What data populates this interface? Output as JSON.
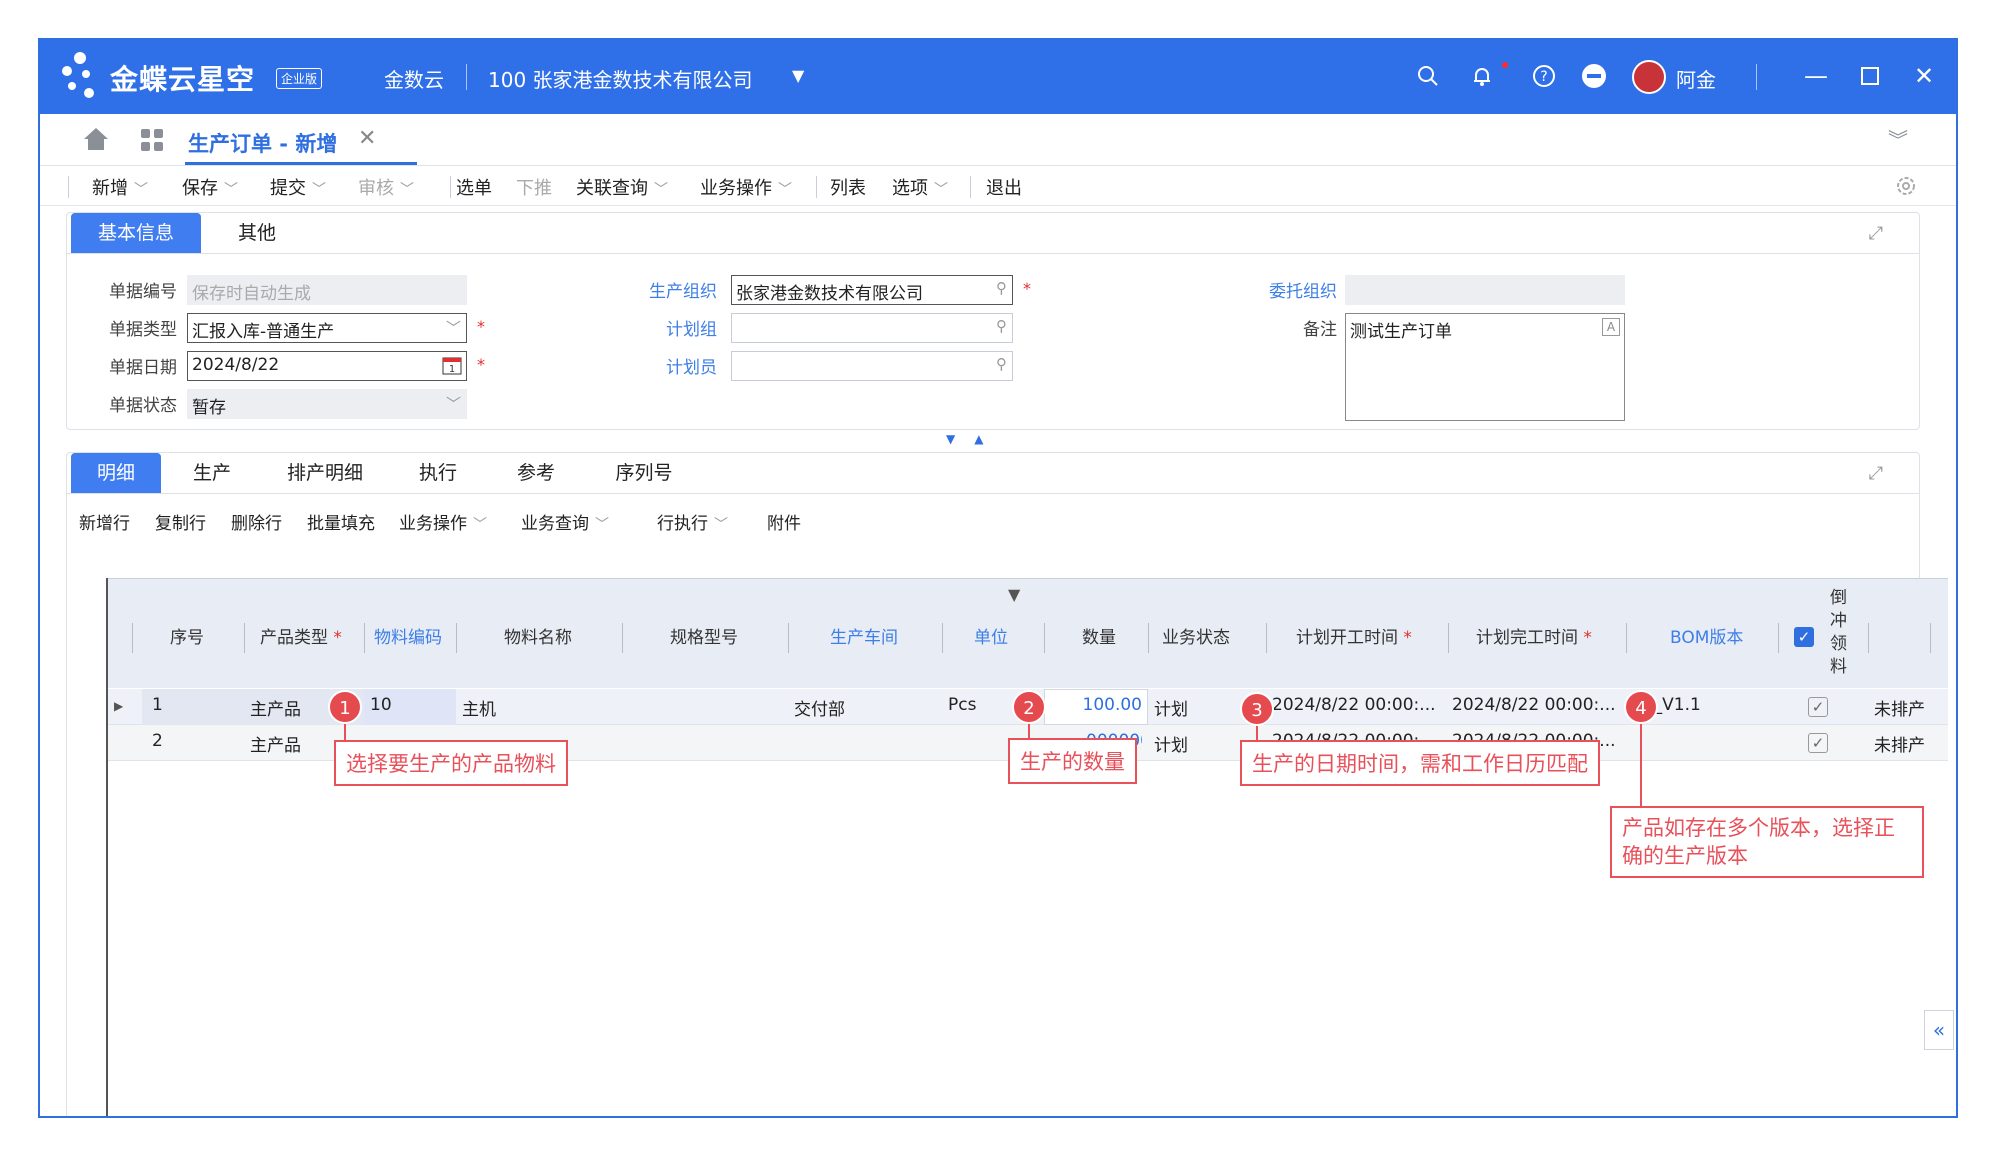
{
  "titlebar": {
    "brand": "金蝶云星空",
    "edition": "企业版",
    "product": "金数云",
    "company": "100  张家港金数技术有限公司",
    "user": "阿金"
  },
  "tabstrip": {
    "doc_tab": "生产订单 - 新增"
  },
  "toolbar": {
    "items": [
      "新增",
      "保存",
      "提交",
      "审核",
      "选单",
      "下推",
      "关联查询",
      "业务操作",
      "列表",
      "选项",
      "退出"
    ]
  },
  "header_panel": {
    "tabs": [
      "基本信息",
      "其他"
    ],
    "fields": {
      "bill_no_label": "单据编号",
      "bill_no_placeholder": "保存时自动生成",
      "bill_type_label": "单据类型",
      "bill_type": "汇报入库-普通生产",
      "bill_date_label": "单据日期",
      "bill_date": "2024/8/22",
      "bill_status_label": "单据状态",
      "bill_status": "暂存",
      "prod_org_label": "生产组织",
      "prod_org": "张家港金数技术有限公司",
      "plan_group_label": "计划组",
      "planner_label": "计划员",
      "entrust_org_label": "委托组织",
      "remark_label": "备注",
      "remark": "测试生产订单"
    }
  },
  "detail_panel": {
    "tabs": [
      "明细",
      "生产",
      "排产明细",
      "执行",
      "参考",
      "序列号"
    ],
    "actions": [
      "新增行",
      "复制行",
      "删除行",
      "批量填充",
      "业务操作",
      "业务查询",
      "行执行",
      "附件"
    ],
    "columns": [
      "序号",
      "产品类型",
      "物料编码",
      "物料名称",
      "规格型号",
      "生产车间",
      "单位",
      "数量",
      "业务状态",
      "计划开工时间",
      "计划完工时间",
      "BOM版本",
      "倒冲领料"
    ],
    "rows": [
      {
        "seq": "1",
        "type": "主产品",
        "code": "10",
        "name": "主机",
        "spec": "",
        "workshop": "交付部",
        "unit": "Pcs",
        "qty": "100.00",
        "status": "计划",
        "start": "2024/8/22 00:00:...",
        "end": "2024/8/22 00:00:...",
        "bom": "10_V1.1",
        "extra": "未排产"
      },
      {
        "seq": "2",
        "type": "主产品",
        "code": "",
        "name": "",
        "spec": "",
        "workshop": "",
        "unit": "",
        "qty": "0000000",
        "status": "计划",
        "start": "2024/8/22 00:00:...",
        "end": "2024/8/22 00:00:...",
        "bom": "",
        "extra": "未排产"
      }
    ]
  },
  "callouts": {
    "c1": {
      "num": "1",
      "text": "选择要生产的产品物料"
    },
    "c2": {
      "num": "2",
      "text": "生产的数量"
    },
    "c3": {
      "num": "3",
      "text": "生产的日期时间，需和工作日历匹配"
    },
    "c4": {
      "num": "4",
      "text": "产品如存在多个版本，选择正确的生产版本"
    }
  },
  "colors": {
    "brand_blue": "#2f6fe8",
    "callout_red": "#e8505a"
  }
}
